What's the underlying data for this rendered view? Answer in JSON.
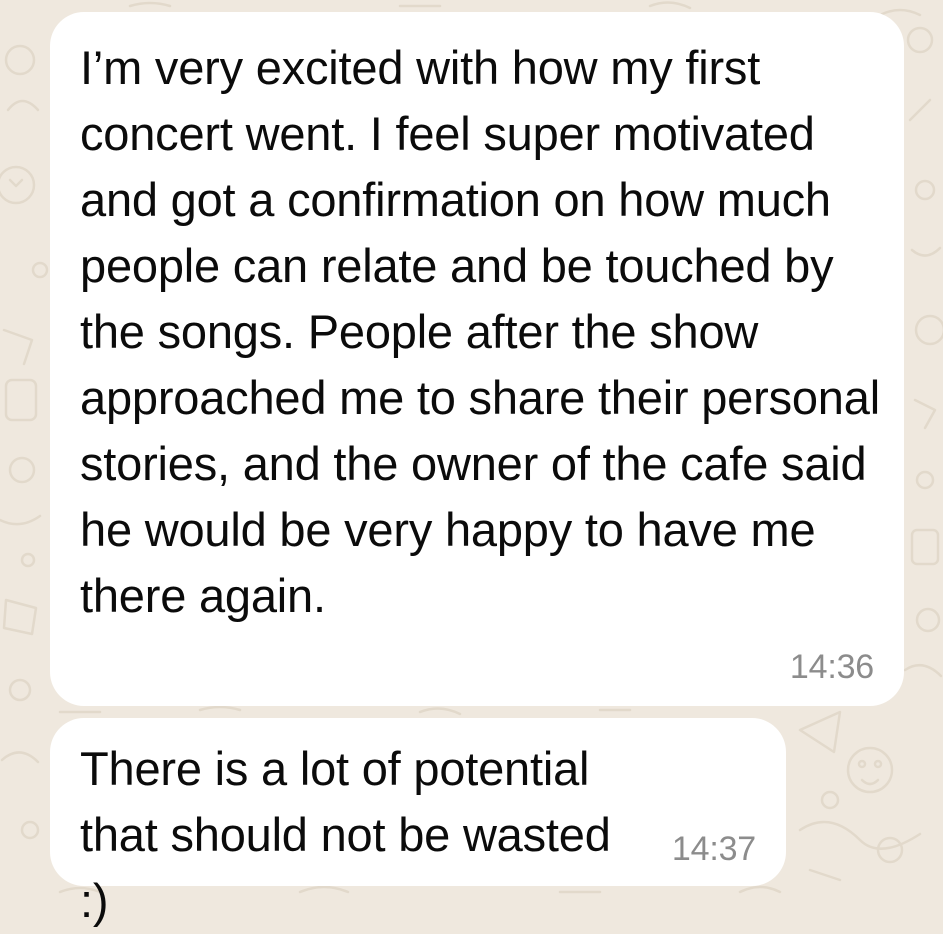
{
  "chat": {
    "background_color": "#efe8de",
    "bubble_color": "#ffffff",
    "messages": [
      {
        "text": "I’m very excited with how my first concert went. I feel super motivated and got a confirmation on how much people can relate and be touched by the songs. People after the show approached me to share their personal stories, and the owner of the cafe said he would be very happy to have me there again.",
        "time": "14:36"
      },
      {
        "text": "There is a lot of potential that should not be wasted :)",
        "time": "14:37"
      }
    ]
  }
}
